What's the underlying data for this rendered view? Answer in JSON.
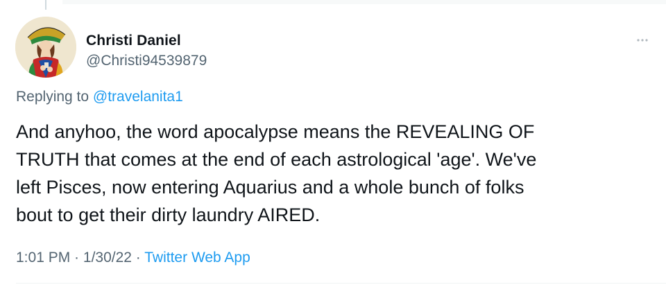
{
  "author": {
    "display_name": "Christi Daniel",
    "handle": "@Christi94539879",
    "avatar_icon": "tarot-card-avatar-icon"
  },
  "reply": {
    "prefix": "Replying to ",
    "mention": "@travelanita1"
  },
  "tweet": {
    "text": "And anyhoo, the word apocalypse means the REVEALING OF\nTRUTH that comes at the end of each astrological 'age'.  We've\nleft Pisces, now  entering Aquarius and a whole bunch of folks\nbout to get their dirty laundry AIRED."
  },
  "meta": {
    "time": "1:01 PM",
    "separator": " · ",
    "date": "1/30/22",
    "separator2": " · ",
    "source": "Twitter Web App"
  },
  "more_icon": "more-options-icon",
  "colors": {
    "text_primary": "#0f1419",
    "text_secondary": "#536471",
    "accent": "#1d9bf0"
  }
}
